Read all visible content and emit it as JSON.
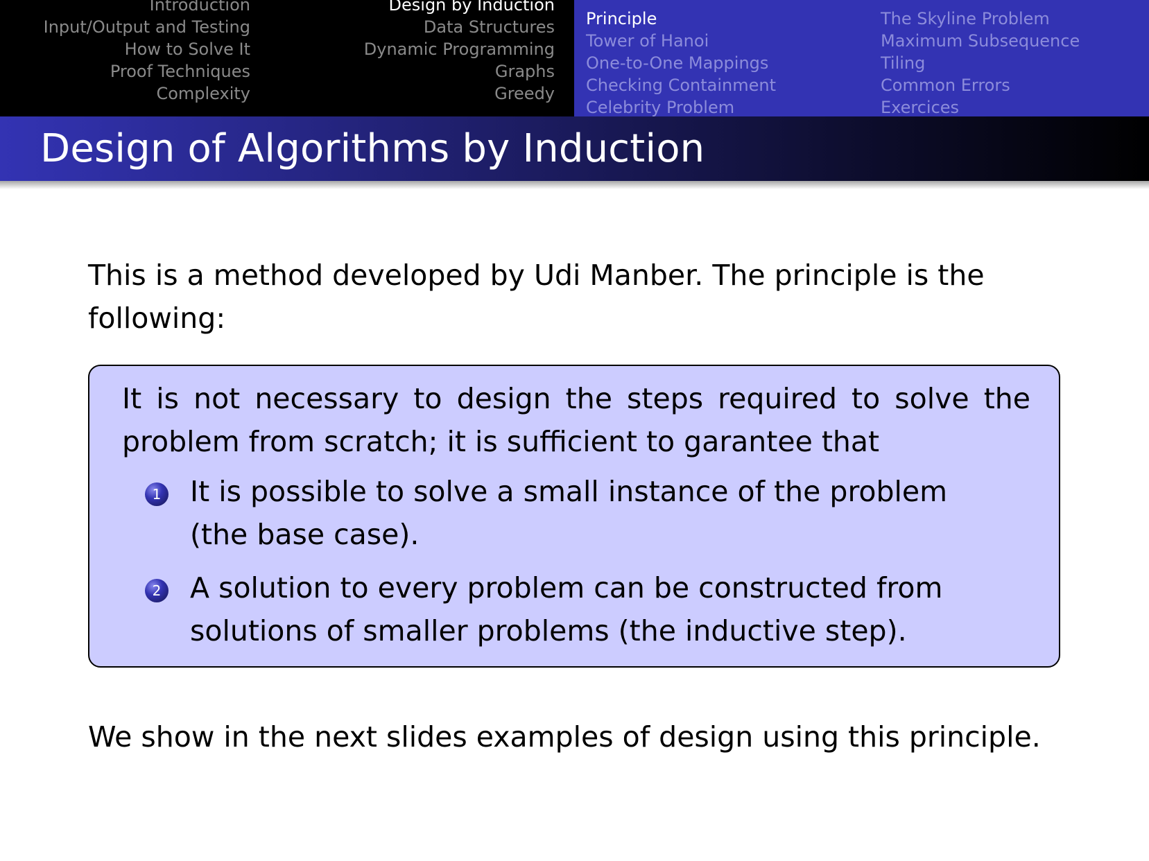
{
  "nav": {
    "sections_col1": [
      "Introduction",
      "Input/Output and Testing",
      "How to Solve It",
      "Proof Techniques",
      "Complexity"
    ],
    "sections_col2": [
      "Design by Induction",
      "Data Structures",
      "Dynamic Programming",
      "Graphs",
      "Greedy"
    ],
    "active_section": "Design by Induction",
    "subsections_col1": [
      "Principle",
      "Tower of Hanoi",
      "One-to-One Mappings",
      "Checking Containment",
      "Celebrity Problem"
    ],
    "subsections_col2": [
      "The Skyline Problem",
      "Maximum Subsequence",
      "Tiling",
      "Common Errors",
      "Exercices"
    ],
    "active_subsection": "Principle"
  },
  "frame": {
    "title": "Design of Algorithms by Induction"
  },
  "content": {
    "intro": "This is a method developed by Udi Manber. The principle is the following:",
    "box_text": "It is not necessary to design the steps required to solve the problem from scratch; it is sufficient to garantee that",
    "items": [
      {
        "number": "1",
        "text": "It is possible to solve a small instance of the problem (the base case)."
      },
      {
        "number": "2",
        "text": "A solution to every problem can be constructed from solutions of smaller problems (the inductive step)."
      }
    ],
    "closing": "We show in the next slides examples of design using this principle."
  },
  "colors": {
    "theme_blue": "#3333b3",
    "box_fill": "#ccccff",
    "inactive_nav": "#8a8a8a",
    "inactive_subnav": "#8c8cdb"
  }
}
